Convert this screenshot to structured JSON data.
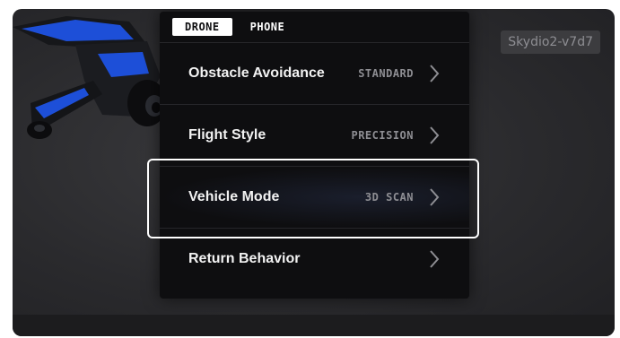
{
  "tabs": [
    {
      "label": "DRONE",
      "active": true
    },
    {
      "label": "PHONE",
      "active": false
    }
  ],
  "device_name": "Skydio2-v7d7",
  "settings": [
    {
      "label": "Obstacle Avoidance",
      "value": "STANDARD"
    },
    {
      "label": "Flight Style",
      "value": "PRECISION"
    },
    {
      "label": "Vehicle Mode",
      "value": "3D SCAN"
    },
    {
      "label": "Return Behavior",
      "value": ""
    }
  ],
  "colors": {
    "panel_bg": "#0e0e10",
    "screen_bg": "#2a2a2d",
    "drone_accent": "#1d4fd8",
    "focus_frame": "#ffffff"
  },
  "icons": {
    "row_arrow": "chevron-right-icon"
  }
}
